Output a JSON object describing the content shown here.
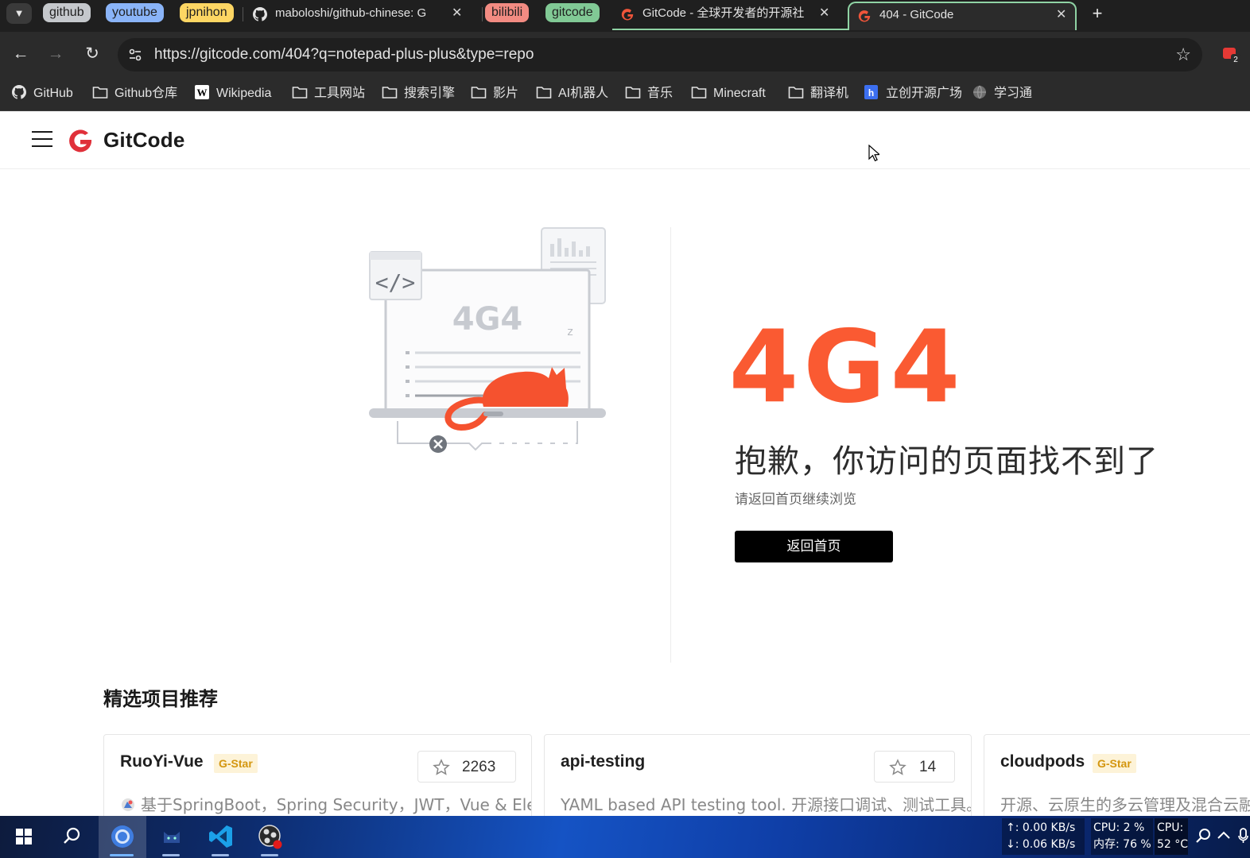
{
  "browser": {
    "tab_groups": [
      {
        "label": "github",
        "color": "#c5c8cc"
      },
      {
        "label": "youtube",
        "color": "#8ab4f8"
      },
      {
        "label": "jpnihon",
        "color": "#fdd663"
      },
      {
        "label": "bilibili",
        "color": "#f28b82"
      },
      {
        "label": "gitcode",
        "color": "#81c995"
      }
    ],
    "tabs": [
      {
        "title": "maboloshi/github-chinese: G",
        "icon": "github-icon"
      },
      {
        "title": "GitCode - 全球开发者的开源社",
        "icon": "gitcode-icon"
      },
      {
        "title": "404 - GitCode",
        "icon": "gitcode-icon",
        "active": true
      }
    ],
    "url": "https://gitcode.com/404?q=notepad-plus-plus&type=repo",
    "extension_badge": "2",
    "bookmarks": [
      {
        "label": "GitHub",
        "icon": "github-icon"
      },
      {
        "label": "Github仓库",
        "icon": "folder-icon"
      },
      {
        "label": "Wikipedia",
        "icon": "wikipedia-icon"
      },
      {
        "label": "工具网站",
        "icon": "folder-icon"
      },
      {
        "label": "搜索引擎",
        "icon": "folder-icon"
      },
      {
        "label": "影片",
        "icon": "folder-icon"
      },
      {
        "label": "AI机器人",
        "icon": "folder-icon"
      },
      {
        "label": "音乐",
        "icon": "folder-icon"
      },
      {
        "label": "Minecraft",
        "icon": "folder-icon"
      },
      {
        "label": "翻译机",
        "icon": "folder-icon"
      },
      {
        "label": "立创开源广场",
        "icon": "oshwhub-icon"
      },
      {
        "label": "学习通",
        "icon": "globe-icon"
      }
    ]
  },
  "site": {
    "logo_text": "GitCode",
    "brand_color": "#e63c3c"
  },
  "error": {
    "code": "404",
    "illustration_text": "4G4",
    "title": "抱歉，你访问的页面找不到了",
    "hint": "请返回首页继续浏览",
    "home_button": "返回首页",
    "accent_color": "#fa5a32"
  },
  "recommended": {
    "title": "精选项目推荐",
    "cards": [
      {
        "name": "RuoYi-Vue",
        "badge": "G-Star",
        "stars": "2263",
        "desc": "基于SpringBoot，Spring Security，JWT，Vue & Elemen"
      },
      {
        "name": "api-testing",
        "badge": "",
        "stars": "14",
        "desc": "YAML based API testing tool. 开源接口调试、测试工具。"
      },
      {
        "name": "cloudpods",
        "badge": "G-Star",
        "stars": "",
        "desc": "开源、云原生的多云管理及混合云融合平"
      }
    ]
  },
  "taskbar": {
    "net_up": "↑: 0.00 KB/s",
    "net_down": "↓: 0.06 KB/s",
    "cpu": "CPU: 2 %",
    "mem": "内存: 76 %",
    "cpu2_label": "CPU:",
    "cpu_temp": "52 °C"
  }
}
